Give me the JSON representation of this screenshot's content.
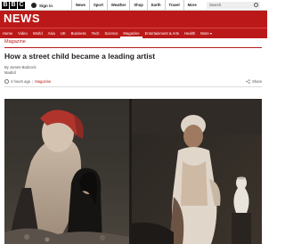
{
  "topbar": {
    "logo_letters": [
      "B",
      "B",
      "C"
    ],
    "signin_label": "Sign in",
    "nav_items": [
      "News",
      "Sport",
      "Weather",
      "Shop",
      "Earth",
      "Travel",
      "More"
    ],
    "search_placeholder": "Search"
  },
  "brand": {
    "title": "NEWS",
    "accent_color": "#bb1919"
  },
  "nav": {
    "items": [
      "Home",
      "Video",
      "World",
      "Asia",
      "UK",
      "Business",
      "Tech",
      "Science",
      "Magazine",
      "Entertainment & Arts",
      "Health",
      "More ▾"
    ],
    "active": "Magazine"
  },
  "article": {
    "section": "Magazine",
    "headline": "How a street child became a leading artist",
    "byline": "By James Badcock",
    "location": "Madrid",
    "timestamp": "4 hours ago",
    "section_link": "Magazine",
    "share_label": "Share"
  },
  "icons": {
    "signin": "user-icon",
    "search": "search-icon",
    "clock": "clock-icon",
    "share": "share-icon"
  }
}
